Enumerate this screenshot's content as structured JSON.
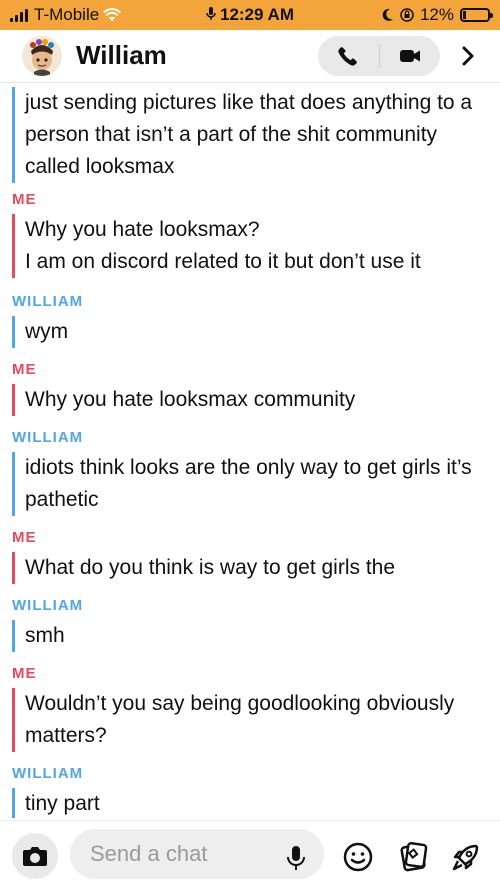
{
  "status_bar": {
    "carrier": "T-Mobile",
    "time": "12:29 AM",
    "battery_percent_text": "12%",
    "battery_level": 0.12
  },
  "header": {
    "contact_name": "William",
    "icons": [
      "avatar",
      "phone-icon",
      "video-icon",
      "chevron-right-icon"
    ]
  },
  "messages": [
    {
      "sender": "",
      "text": "just sending pictures like that does anything to a person that isn’t a part of the shit community called looksmax"
    },
    {
      "sender": "ME",
      "text": "Why you hate looksmax?\nI am on discord related to it but don’t use it"
    },
    {
      "sender": "WILLIAM",
      "text": "wym"
    },
    {
      "sender": "ME",
      "text": "Why you hate looksmax community"
    },
    {
      "sender": "WILLIAM",
      "text": "idiots think looks are the only way to get girls it’s pathetic"
    },
    {
      "sender": "ME",
      "text": "What do you think is way to get girls the"
    },
    {
      "sender": "WILLIAM",
      "text": "smh"
    },
    {
      "sender": "ME",
      "text": "Wouldn’t you say being goodlooking obviously matters?"
    },
    {
      "sender": "WILLIAM",
      "text": "tiny part"
    }
  ],
  "composer": {
    "placeholder": "Send a chat",
    "icons": [
      "camera-icon",
      "mic-icon",
      "emoji-icon",
      "stickers-icon",
      "rocket-icon"
    ]
  },
  "colors": {
    "status_bar_bg": "#f3a43a",
    "me_accent": "#e54b5b",
    "william_accent": "#4fa6e8"
  }
}
